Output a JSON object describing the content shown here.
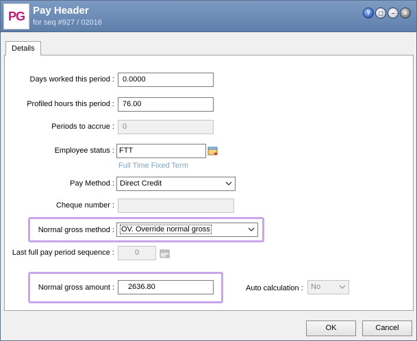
{
  "window": {
    "logo": "PG",
    "title": "Pay Header",
    "subtitle": "for seq #927 / 02016",
    "buttons": {
      "help": "?",
      "restore": "◻",
      "minimize": "–",
      "close": "✕"
    }
  },
  "tabs": [
    {
      "label": "Details",
      "active": true
    }
  ],
  "form": {
    "days_worked": {
      "label": "Days worked this period :",
      "value": "0.0000"
    },
    "profiled_hours": {
      "label": "Profiled hours this period :",
      "value": "76.00"
    },
    "periods_to_accrue": {
      "label": "Periods to accrue :",
      "value": "0"
    },
    "employee_status": {
      "label": "Employee status :",
      "value": "FTT",
      "hint": "Full Time Fixed Term"
    },
    "pay_method": {
      "label": "Pay Method :",
      "value": "Direct Credit"
    },
    "cheque_number": {
      "label": "Cheque number :",
      "value": ""
    },
    "normal_gross_method": {
      "label": "Normal gross method :",
      "value": "OV. Override normal gross"
    },
    "last_full_pay_period_sequence": {
      "label": "Last full pay period sequence :",
      "value": "0"
    },
    "normal_gross_amount": {
      "label": "Normal gross amount :",
      "value": "2636.80"
    },
    "auto_calculation": {
      "label": "Auto calculation :",
      "value": "No"
    }
  },
  "footer": {
    "ok_label": "OK",
    "cancel_label": "Cancel"
  },
  "colors": {
    "highlight": "#c9a6ec",
    "hint": "#7fa3c6",
    "title_bar": "#6b8bb7",
    "logo": "#c2187a"
  }
}
